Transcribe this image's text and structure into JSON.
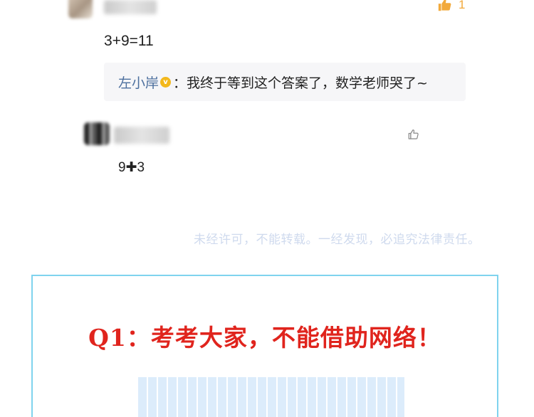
{
  "comments": [
    {
      "text": "3+9=11",
      "like_count": "1",
      "reply": {
        "author": "左小岸",
        "badge": "v",
        "separator": "：",
        "content": "我终于等到这个答案了，数学老师哭了~"
      }
    },
    {
      "text": "9✚3"
    }
  ],
  "watermark": "未经许可，不能转载。一经发现，必追究法律责任。",
  "question": {
    "title": "Q1：考考大家，不能借助网络！"
  },
  "colors": {
    "like": "#f2a93b",
    "reply_author": "#4c6f9e",
    "verified_badge": "#f3b81c",
    "watermark": "#cfdaee",
    "question_border": "#7fd3ee",
    "question_title": "#e0241d"
  },
  "icons": [
    "thumbs-up-icon",
    "verified-badge-icon"
  ]
}
